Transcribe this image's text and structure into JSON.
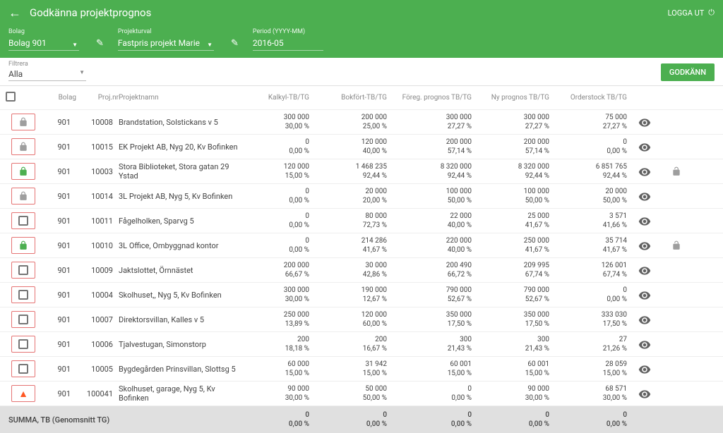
{
  "header": {
    "title": "Godkänna projektprognos",
    "logout": "LOGGA UT"
  },
  "filters": {
    "bolag_label": "Bolag",
    "bolag_value": "Bolag 901",
    "projekt_label": "Projekturval",
    "projekt_value": "Fastpris projekt Marie",
    "period_label": "Period (YYYY-MM)",
    "period_value": "2016-05"
  },
  "subbar": {
    "filter_label": "Filtrera",
    "filter_value": "Alla",
    "approve": "GODKÄNN"
  },
  "columns": {
    "bolag": "Bolag",
    "projnr": "Proj.nr",
    "projektnamn": "Projektnamn",
    "kalkyl": "Kalkyl-TB/TG",
    "bokfort": "Bokfört-TB/TG",
    "foreg": "Föreg. prognos TB/TG",
    "ny": "Ny prognos TB/TG",
    "orderstock": "Orderstock TB/TG"
  },
  "rows": [
    {
      "status": "lock-gray",
      "bolag": "901",
      "projnr": "10008",
      "name": "Brandstation, Solstickans v 5",
      "kalkyl": [
        "300 000",
        "30,00 %"
      ],
      "bokfort": [
        "200 000",
        "25,00 %"
      ],
      "foreg": [
        "300 000",
        "27,27 %"
      ],
      "ny": [
        "300 000",
        "27,27 %"
      ],
      "order": [
        "75 000",
        "27,27 %"
      ],
      "locked": false
    },
    {
      "status": "lock-gray",
      "bolag": "901",
      "projnr": "10015",
      "name": "EK Projekt AB, Nyg 20, Kv Bofinken",
      "kalkyl": [
        "0",
        "0,00 %"
      ],
      "bokfort": [
        "120 000",
        "40,00 %"
      ],
      "foreg": [
        "200 000",
        "57,14 %"
      ],
      "ny": [
        "200 000",
        "57,14 %"
      ],
      "order": [
        "0",
        "0,00 %"
      ],
      "locked": false
    },
    {
      "status": "lock-green",
      "bolag": "901",
      "projnr": "10003",
      "name": "Stora Biblioteket, Stora gatan 29 Ystad",
      "kalkyl": [
        "120 000",
        "15,00 %"
      ],
      "bokfort": [
        "1 468 235",
        "92,44 %"
      ],
      "foreg": [
        "8 320 000",
        "92,44 %"
      ],
      "ny": [
        "8 320 000",
        "92,44 %"
      ],
      "order": [
        "6 851 765",
        "92,44 %"
      ],
      "locked": true
    },
    {
      "status": "lock-gray",
      "bolag": "901",
      "projnr": "10014",
      "name": "3L Projekt AB, Nyg 5, Kv Bofinken",
      "kalkyl": [
        "0",
        "0,00 %"
      ],
      "bokfort": [
        "20 000",
        "20,00 %"
      ],
      "foreg": [
        "100 000",
        "50,00 %"
      ],
      "ny": [
        "100 000",
        "50,00 %"
      ],
      "order": [
        "20 000",
        "50,00 %"
      ],
      "locked": false
    },
    {
      "status": "checkbox",
      "bolag": "901",
      "projnr": "10011",
      "name": "Fågelholken, Sparvg 5",
      "kalkyl": [
        "0",
        "0,00 %"
      ],
      "bokfort": [
        "80 000",
        "72,73 %"
      ],
      "foreg": [
        "22 000",
        "40,00 %"
      ],
      "ny": [
        "25 000",
        "41,67 %"
      ],
      "order": [
        "3 571",
        "41,66 %"
      ],
      "locked": false
    },
    {
      "status": "lock-green",
      "bolag": "901",
      "projnr": "10010",
      "name": "3L Office, Ombyggnad kontor",
      "kalkyl": [
        "0",
        "0,00 %"
      ],
      "bokfort": [
        "214 286",
        "41,67 %"
      ],
      "foreg": [
        "220 000",
        "40,00 %"
      ],
      "ny": [
        "250 000",
        "41,67 %"
      ],
      "order": [
        "35 714",
        "41,67 %"
      ],
      "locked": true
    },
    {
      "status": "checkbox",
      "bolag": "901",
      "projnr": "10009",
      "name": "Jaktslottet, Örnnästet",
      "kalkyl": [
        "200 000",
        "66,67 %"
      ],
      "bokfort": [
        "30 000",
        "42,86 %"
      ],
      "foreg": [
        "200 490",
        "66,72 %"
      ],
      "ny": [
        "209 995",
        "67,74 %"
      ],
      "order": [
        "126 001",
        "67,74 %"
      ],
      "locked": false
    },
    {
      "status": "checkbox",
      "bolag": "901",
      "projnr": "10004",
      "name": "Skolhuset,, Nyg 5, Kv Bofinken",
      "kalkyl": [
        "300 000",
        "30,00 %"
      ],
      "bokfort": [
        "190 000",
        "12,67 %"
      ],
      "foreg": [
        "790 000",
        "52,67 %"
      ],
      "ny": [
        "790 000",
        "52,67 %"
      ],
      "order": [
        "0",
        "0,00 %"
      ],
      "locked": false
    },
    {
      "status": "checkbox",
      "bolag": "901",
      "projnr": "10007",
      "name": "Direktorsvillan, Kalles v 5",
      "kalkyl": [
        "250 000",
        "13,89 %"
      ],
      "bokfort": [
        "120 000",
        "60,00 %"
      ],
      "foreg": [
        "350 000",
        "17,50 %"
      ],
      "ny": [
        "350 000",
        "17,50 %"
      ],
      "order": [
        "333 030",
        "17,50 %"
      ],
      "locked": false
    },
    {
      "status": "checkbox",
      "bolag": "901",
      "projnr": "10006",
      "name": "Tjalvestugan, Simonstorp",
      "kalkyl": [
        "200",
        "18,18 %"
      ],
      "bokfort": [
        "200",
        "16,67 %"
      ],
      "foreg": [
        "300",
        "21,43 %"
      ],
      "ny": [
        "300",
        "21,43 %"
      ],
      "order": [
        "27",
        "21,26 %"
      ],
      "locked": false
    },
    {
      "status": "checkbox",
      "bolag": "901",
      "projnr": "10005",
      "name": "Bygdegården Prinsvillan, Slottsg 5",
      "kalkyl": [
        "60 000",
        "15,00 %"
      ],
      "bokfort": [
        "31 942",
        "15,00 %"
      ],
      "foreg": [
        "60 001",
        "15,00 %"
      ],
      "ny": [
        "60 001",
        "15,00 %"
      ],
      "order": [
        "28 059",
        "15,00 %"
      ],
      "locked": false
    },
    {
      "status": "warn",
      "bolag": "901",
      "projnr": "100041",
      "name": "Skolhuset, garage, Nyg 5, Kv Bofinken",
      "kalkyl": [
        "90 000",
        "30,00 %"
      ],
      "bokfort": [
        "50 000",
        "50,00 %"
      ],
      "foreg": [
        "0",
        "0,00 %"
      ],
      "ny": [
        "90 000",
        "30,00 %"
      ],
      "order": [
        "68 571",
        "30,00 %"
      ],
      "locked": false
    }
  ],
  "footer": {
    "label": "SUMMA, TB (Genomsnitt TG)",
    "kalkyl": [
      "0",
      "0,00 %"
    ],
    "bokfort": [
      "0",
      "0,00 %"
    ],
    "foreg": [
      "0",
      "0,00 %"
    ],
    "ny": [
      "0",
      "0,00 %"
    ],
    "order": [
      "0",
      "0,00 %"
    ]
  }
}
